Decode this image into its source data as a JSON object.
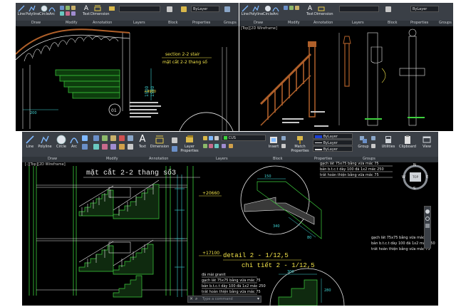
{
  "top_left": {
    "ribbon": {
      "tools": [
        "Line",
        "Polyline",
        "Circle",
        "Arc",
        "Text",
        "Dimension",
        "Layer Properties"
      ],
      "groups": [
        "Draw",
        "Modify",
        "Annotation",
        "Layers",
        "Block",
        "Properties",
        "Groups"
      ],
      "layer_value": "ByLayer"
    },
    "drawing": {
      "section_title": "section 2-2 stair",
      "section_sub": "mặt cắt 2-2 thang số",
      "elev_label": "+4900",
      "circle_label": "01",
      "dim_200": "200",
      "dim_vertical": "1500",
      "dim_vertical_2": "1500"
    }
  },
  "top_right": {
    "ribbon": {
      "tools": [
        "Line",
        "Polyline",
        "Circle",
        "Arc",
        "Text",
        "Dimension",
        "Layer Properties"
      ],
      "groups": [
        "Draw",
        "Modify",
        "Annotation",
        "Layers",
        "Block",
        "Properties",
        "Groups"
      ],
      "layer_value": "ByLayer"
    },
    "viewport_label": "[Top][2D Wireframe]"
  },
  "bottom": {
    "ribbon": {
      "tools": [
        {
          "id": "line",
          "label": "Line"
        },
        {
          "id": "polyline",
          "label": "Polyline"
        },
        {
          "id": "circle",
          "label": "Circle"
        },
        {
          "id": "arc",
          "label": "Arc"
        },
        {
          "id": "text",
          "label": "Text"
        },
        {
          "id": "dimension",
          "label": "Dimension"
        },
        {
          "id": "layer",
          "label": "Layer Properties"
        },
        {
          "id": "insert",
          "label": "Insert"
        },
        {
          "id": "match",
          "label": "Match Properties"
        },
        {
          "id": "group",
          "label": "Group"
        },
        {
          "id": "utilities",
          "label": "Utilities"
        },
        {
          "id": "clipboard",
          "label": "Clipboard"
        },
        {
          "id": "view",
          "label": "View"
        }
      ],
      "groups": [
        "Draw",
        "Modify",
        "Annotation",
        "Layers",
        "Block",
        "Properties",
        "Groups"
      ],
      "layer_value": "CUS",
      "prop_rows": [
        "ByLayer",
        "ByLayer",
        "ByLayer"
      ]
    },
    "viewport_label": "[-][Top][2D Wireframe]",
    "viewcube": {
      "top": "TOP",
      "n": "N",
      "s": "S",
      "e": "E",
      "w": "W"
    },
    "drawing": {
      "main_title": "mặt cắt 2-2 thang số3",
      "elev1": "+20660",
      "elev2": "+17100",
      "detail_title": "detail 2 - 1/12,5",
      "detail_sub": "chi tiết 2 - 1/12,5",
      "notes_right": [
        "gạch lát 75x75 bằng vữa mác 75",
        "bản b.t.c.t dày 100 đá 1x2 mác 250",
        "trát hoàn thiện bằng vữa mác 75"
      ],
      "notes_bottom": [
        "đá mài granit",
        "gạch lát 75x75 bằng vữa mác 75",
        "bản b.t.c.t dày 100 đá 1x2 mác 250",
        "trát hoàn thiện bằng vữa mác 75"
      ],
      "dims": [
        "150",
        "340",
        "300",
        "280",
        "80"
      ]
    },
    "command_placeholder": "Type a command"
  },
  "colors": {
    "ribbon_bg": "#3a3f46",
    "canvas_bg": "#000000",
    "green_lines": "#3ed13e",
    "yellow_text": "#f2e34a",
    "white_lines": "#e8e8e8",
    "cyan_lines": "#40d8d8",
    "brown_rail": "#b0602a"
  }
}
